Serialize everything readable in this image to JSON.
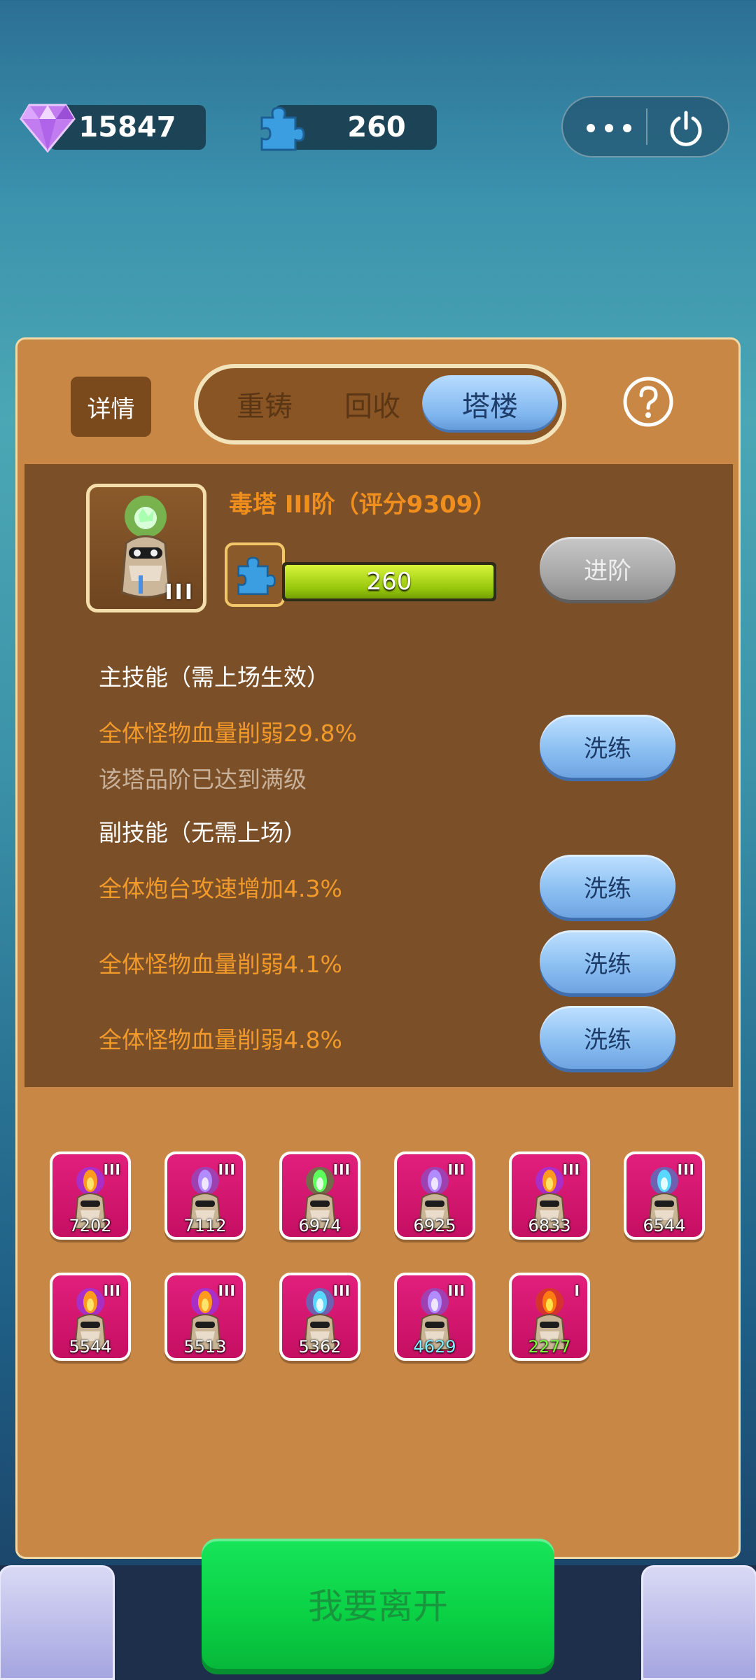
{
  "resources": {
    "gems": "15847",
    "puzzle": "260"
  },
  "tabs": {
    "details": "详情",
    "recast": "重铸",
    "recycle": "回收",
    "tower": "塔楼"
  },
  "tower": {
    "title": "毒塔 III阶（评分9309）",
    "level_badge": "III",
    "progress_value": "260",
    "progress_fraction": 1.0,
    "advance_button": "进阶"
  },
  "skills": {
    "main_header": "主技能（需上场生效）",
    "main_effect": "全体怪物血量削弱29.8%",
    "main_note": "该塔品阶已达到满级",
    "sub_header": "副技能（无需上场）",
    "sub_effects": [
      "全体炮台攻速增加4.3%",
      "全体怪物血量削弱4.1%",
      "全体怪物血量削弱4.8%"
    ],
    "reroll_label": "洗练"
  },
  "tower_list": [
    {
      "score": "7202",
      "level": "III",
      "element": "fire"
    },
    {
      "score": "7112",
      "level": "III",
      "element": "arcane"
    },
    {
      "score": "6974",
      "level": "III",
      "element": "poison"
    },
    {
      "score": "6925",
      "level": "III",
      "element": "arcane"
    },
    {
      "score": "6833",
      "level": "III",
      "element": "fire"
    },
    {
      "score": "6544",
      "level": "III",
      "element": "ice"
    },
    {
      "score": "5544",
      "level": "III",
      "element": "fire"
    },
    {
      "score": "5513",
      "level": "III",
      "element": "fire"
    },
    {
      "score": "5362",
      "level": "III",
      "element": "ice"
    },
    {
      "score": "4629",
      "level": "III",
      "element": "arcane"
    },
    {
      "score": "2277",
      "level": "I",
      "element": "flame"
    }
  ],
  "leave_button": "我要离开",
  "colors": {
    "panel": "#c98745",
    "inner_panel": "#7b4f27",
    "orange_text": "#f19a2b",
    "card": "#d9186f",
    "leave_green": "#0ad044"
  }
}
